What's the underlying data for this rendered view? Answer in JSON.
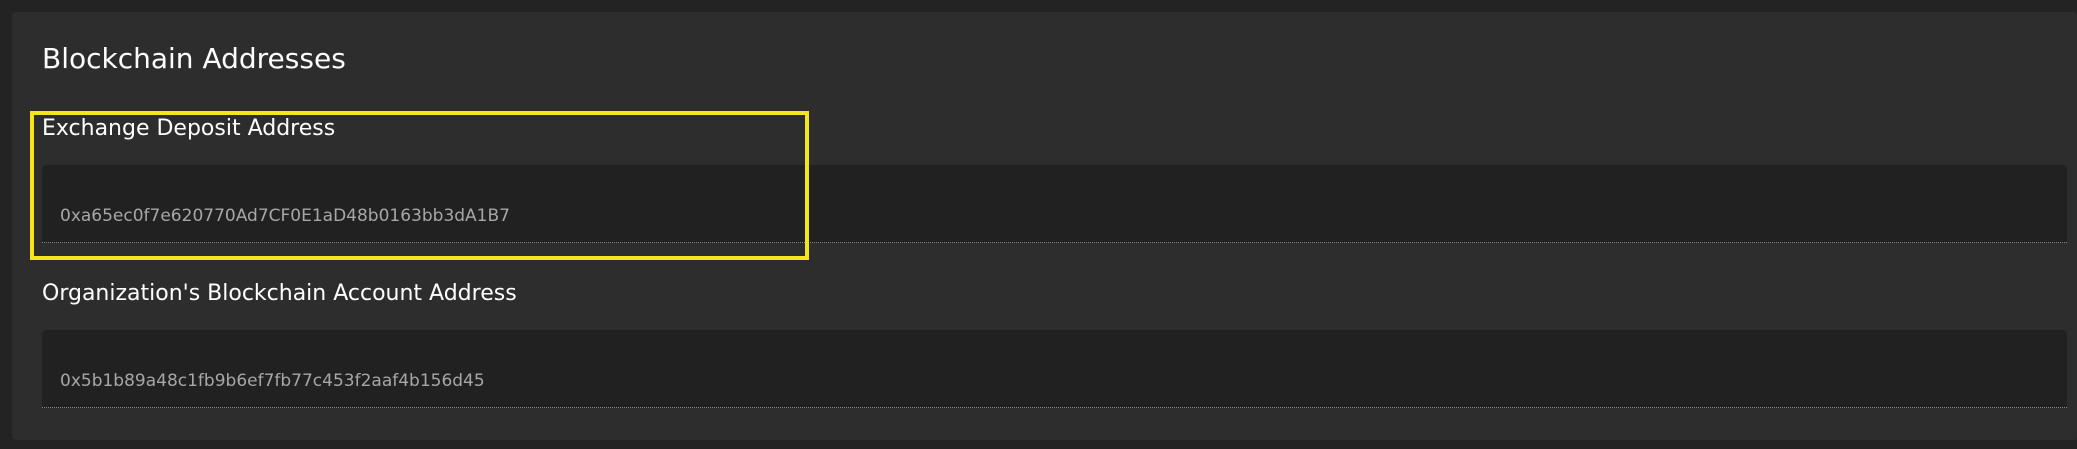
{
  "section": {
    "title": "Blockchain Addresses"
  },
  "fields": [
    {
      "label": "Exchange Deposit Address",
      "value": "0xa65ec0f7e620770Ad7CF0E1aD48b0163bb3dA1B7"
    },
    {
      "label": "Organization's Blockchain Account Address",
      "value": "0x5b1b89a48c1fb9b6ef7fb77c453f2aaf4b156d45"
    }
  ],
  "colors": {
    "background": "#232323",
    "card": "#2d2d2d",
    "input": "#212121",
    "highlight": "#f5e61c",
    "label": "#ffffff",
    "value": "#a7a7a7"
  }
}
